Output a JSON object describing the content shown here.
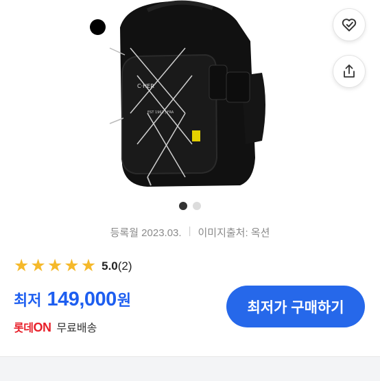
{
  "gallery": {
    "image_name": "black-backpack-photo",
    "page_count": 2,
    "active_page": 1
  },
  "meta": {
    "registered": "등록월 2023.03.",
    "image_source": "이미지출처: 옥션"
  },
  "rating": {
    "stars": 5,
    "value": "5.0",
    "count": "(2)"
  },
  "price": {
    "label": "최저",
    "value": "149,000",
    "unit": "원"
  },
  "shipping": {
    "store_logo_prefix": "롯데",
    "store_logo_suffix": "ON",
    "text": "무료배송"
  },
  "buy_button": {
    "label": "최저가 구매하기"
  },
  "colors": {
    "accent": "#2668ea",
    "price": "#1d5ef0",
    "star": "#f5b92b",
    "store": "#e8202a"
  }
}
